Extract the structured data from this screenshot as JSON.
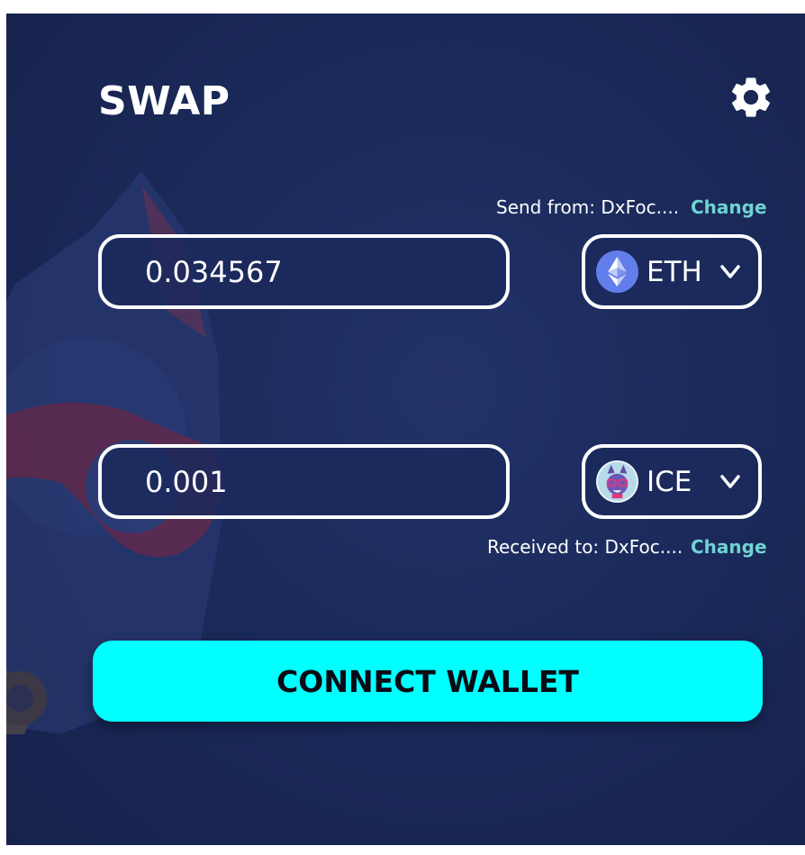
{
  "header": {
    "title": "SWAP",
    "settings_icon": "gear-icon"
  },
  "send": {
    "label": "Send from: DxFoc....",
    "change_label": "Change",
    "amount": "0.034567",
    "token": {
      "symbol": "ETH",
      "icon": "ethereum-icon"
    }
  },
  "receive": {
    "label": "Received to: DxFoc....",
    "change_label": "Change",
    "amount": "0.001",
    "token": {
      "symbol": "ICE",
      "icon": "ice-token-icon"
    }
  },
  "connect_button_label": "CONNECT WALLET",
  "colors": {
    "background": "#1b2a5b",
    "accent": "#00ffff",
    "link": "#6fd3d3",
    "text": "#ffffff",
    "ethereum": "#627eea"
  }
}
